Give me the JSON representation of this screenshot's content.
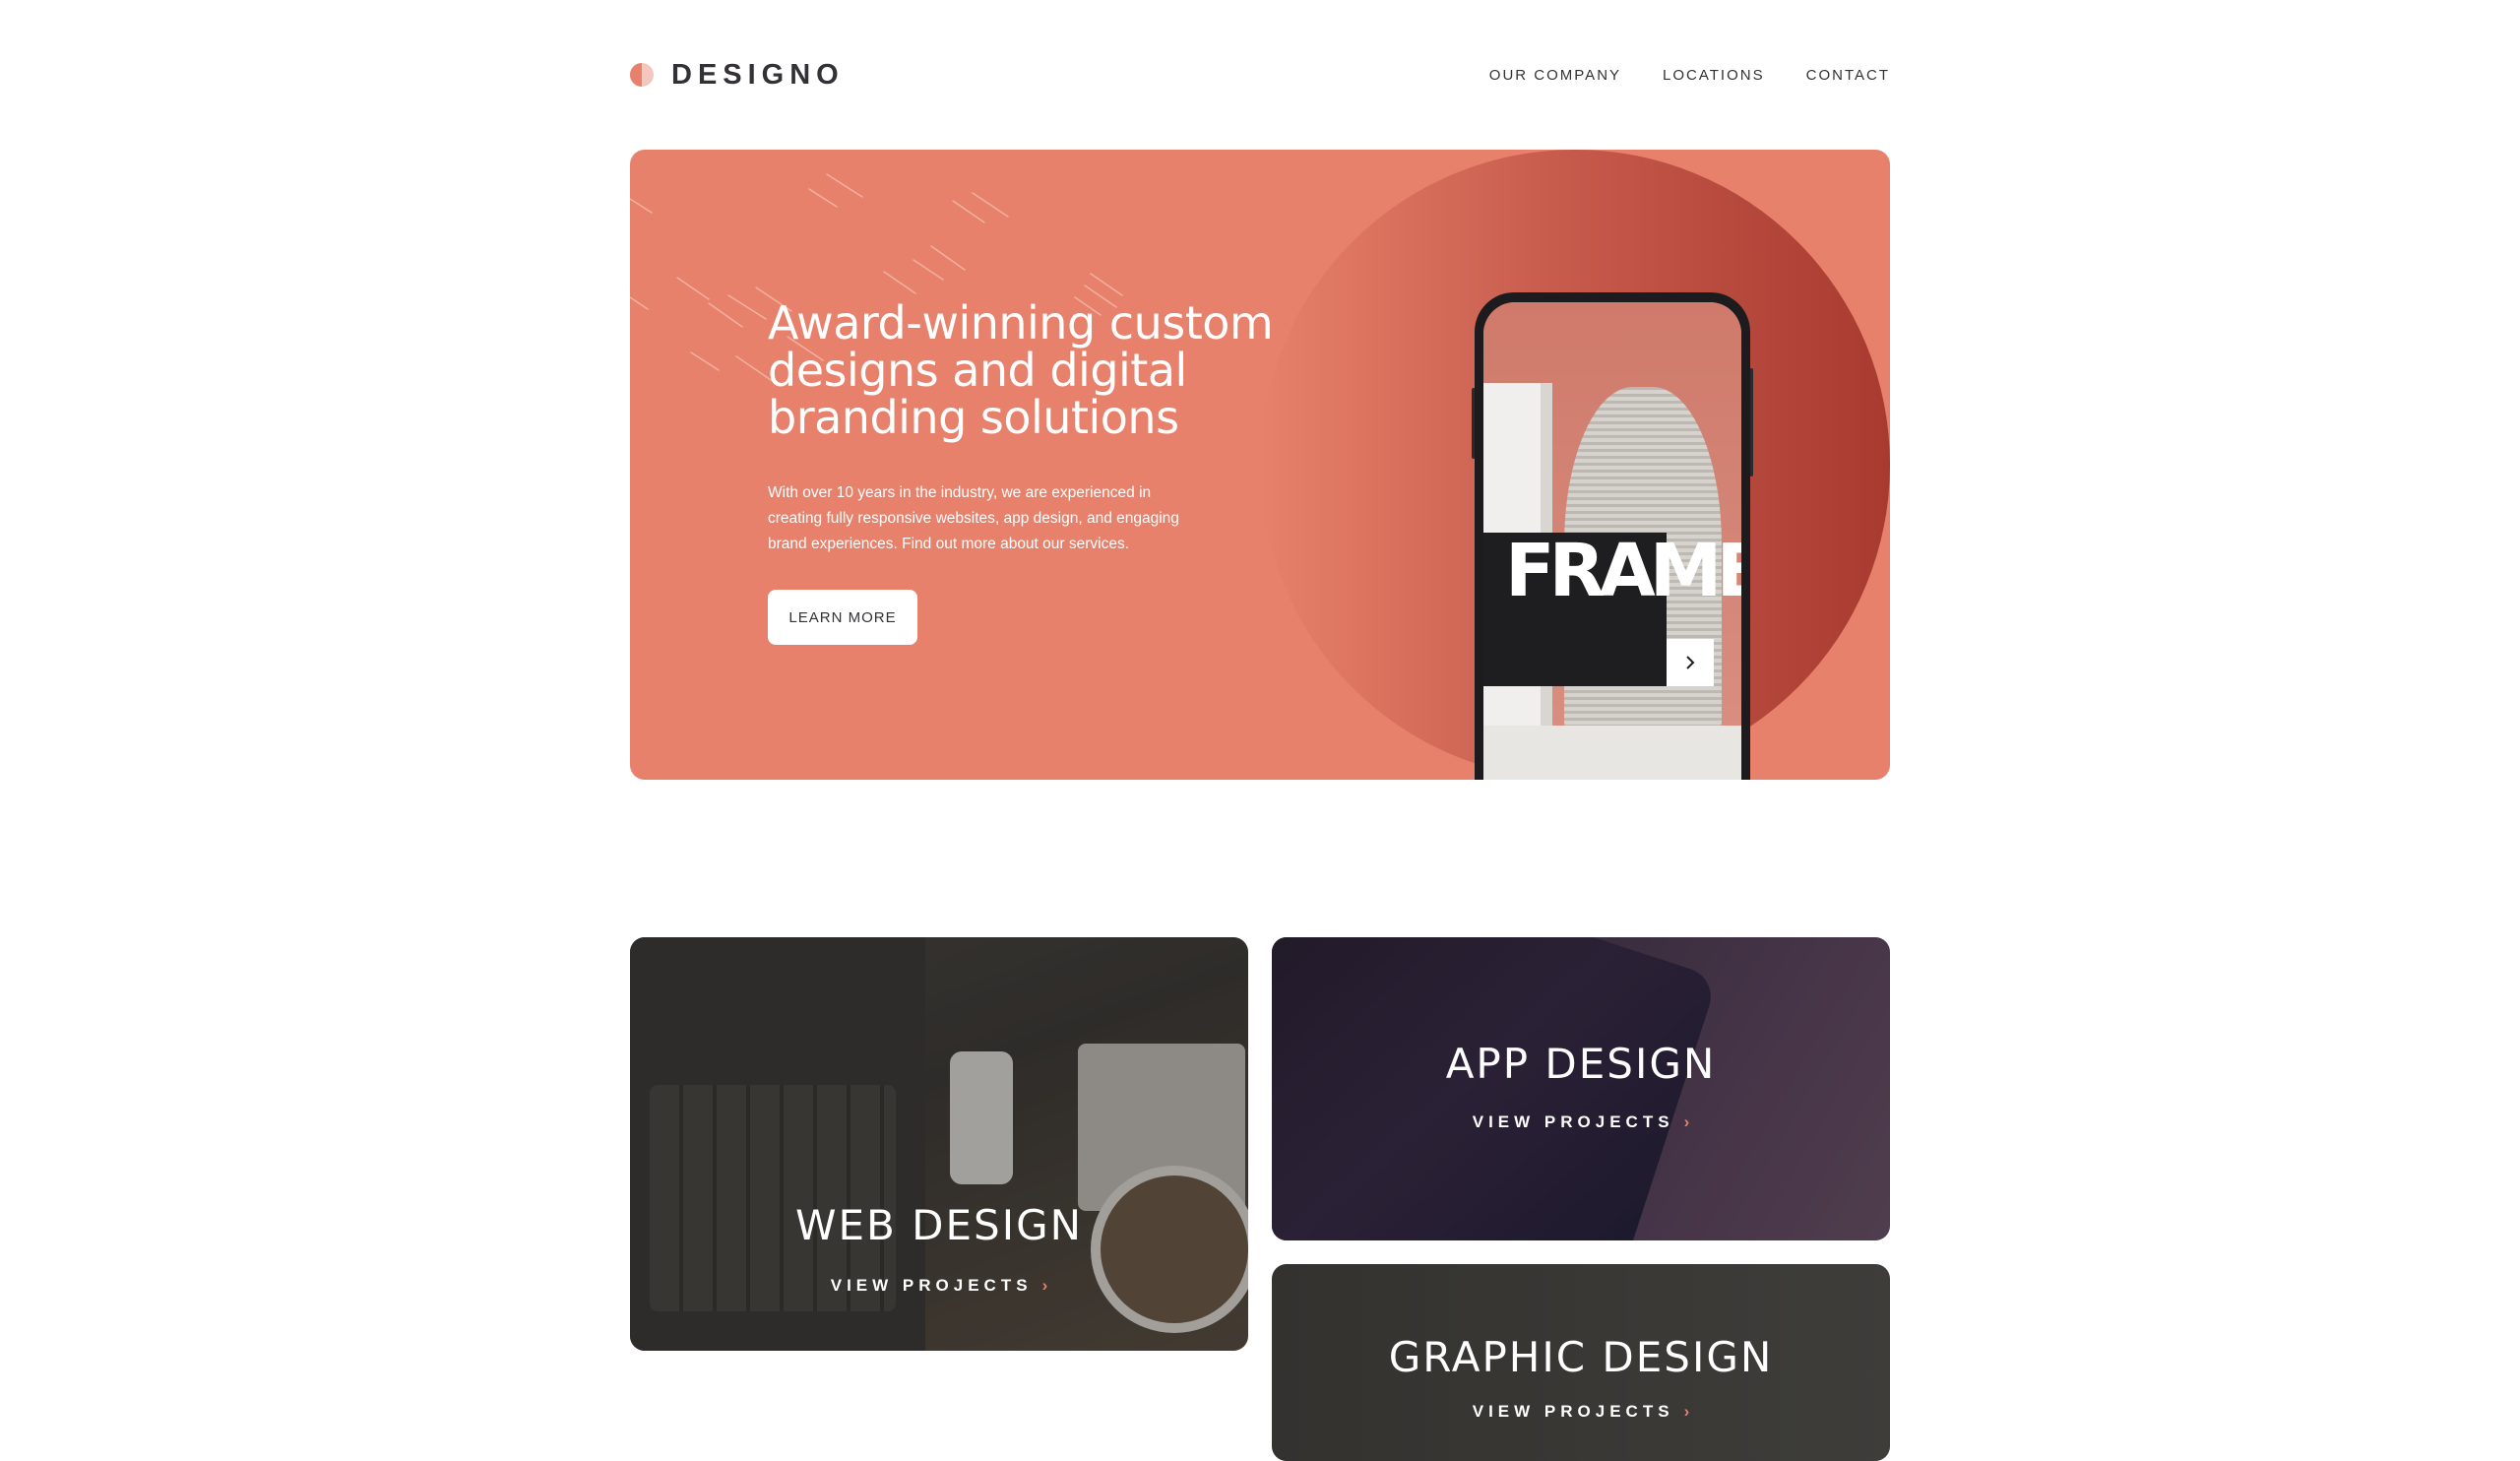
{
  "brand": {
    "name": "DESIGNO",
    "accent": "#e7816b",
    "logo_icon": "half-circle-logo-icon"
  },
  "nav": {
    "items": [
      "OUR COMPANY",
      "LOCATIONS",
      "CONTACT"
    ]
  },
  "hero": {
    "title": "Award-winning custom designs and digital branding solutions",
    "body": "With over 10 years in the industry, we are experienced in creating fully responsive websites, app design, and engaging brand experiences. Find out more about our services.",
    "cta_label": "LEARN MORE",
    "phone_screen_text": "FRAME",
    "phone_next_icon": "chevron-right-icon",
    "background": "#e7816b"
  },
  "projects": [
    {
      "title": "WEB DESIGN",
      "link_label": "VIEW PROJECTS",
      "link_icon": "chevron-right-icon"
    },
    {
      "title": "APP DESIGN",
      "link_label": "VIEW PROJECTS",
      "link_icon": "chevron-right-icon"
    },
    {
      "title": "GRAPHIC DESIGN",
      "link_label": "VIEW PROJECTS",
      "link_icon": "chevron-right-icon"
    }
  ]
}
